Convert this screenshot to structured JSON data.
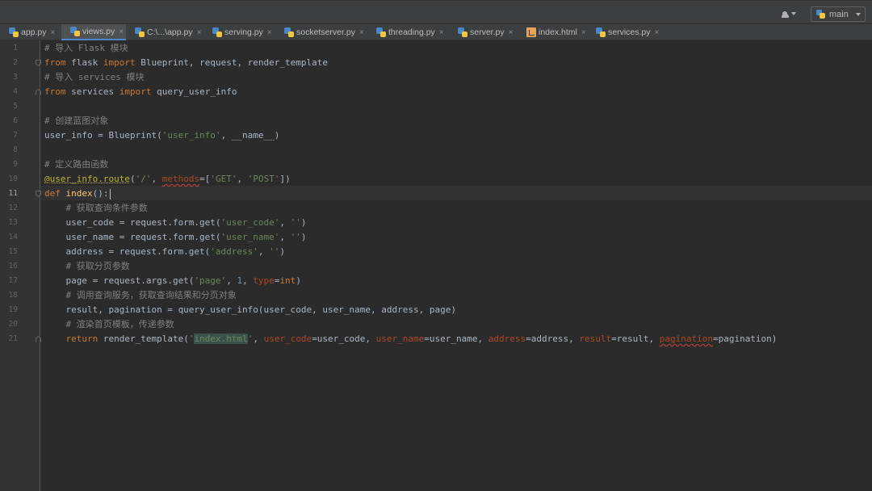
{
  "toolbar": {
    "user_icon": "user-icon",
    "branch_icon": "python-icon",
    "branch": "main"
  },
  "tabs": [
    {
      "label": "app.py",
      "icon": "python-file-icon"
    },
    {
      "label": "views.py",
      "icon": "python-file-icon",
      "active": true
    },
    {
      "label": "C:\\...\\app.py",
      "icon": "python-file-icon"
    },
    {
      "label": "serving.py",
      "icon": "python-file-icon"
    },
    {
      "label": "socketserver.py",
      "icon": "python-file-icon"
    },
    {
      "label": "threading.py",
      "icon": "python-file-icon"
    },
    {
      "label": "server.py",
      "icon": "python-file-icon"
    },
    {
      "label": "index.html",
      "icon": "html-file-icon"
    },
    {
      "label": "services.py",
      "icon": "python-file-icon"
    }
  ],
  "close_glyph": "×",
  "editor": {
    "current_line": "11",
    "line_numbers": [
      "1",
      "2",
      "3",
      "4",
      "5",
      "6",
      "7",
      "8",
      "9",
      "10",
      "11",
      "12",
      "13",
      "14",
      "15",
      "16",
      "17",
      "18",
      "19",
      "20",
      "21"
    ],
    "colors": {
      "keyword": "#cc7832",
      "string": "#6a8759",
      "comment": "#808080",
      "decorator": "#bbb529",
      "number": "#6897bb",
      "param": "#aa4926",
      "default": "#a9b7c6"
    },
    "lines": [
      [
        {
          "t": "# 导入 Flask 模块",
          "c": "c"
        }
      ],
      [
        {
          "t": "from",
          "c": "k"
        },
        {
          "t": " flask "
        },
        {
          "t": "import",
          "c": "k"
        },
        {
          "t": " Blueprint, request, render_template"
        }
      ],
      [
        {
          "t": "# 导入 services 模块",
          "c": "c"
        }
      ],
      [
        {
          "t": "from",
          "c": "k"
        },
        {
          "t": " services "
        },
        {
          "t": "import",
          "c": "k"
        },
        {
          "t": " query_user_info"
        }
      ],
      [],
      [
        {
          "t": "# 创建蓝图对象",
          "c": "c"
        }
      ],
      [
        {
          "t": "user_info = Blueprint("
        },
        {
          "t": "'user_info'",
          "c": "s"
        },
        {
          "t": ", __name__)"
        }
      ],
      [],
      [
        {
          "t": "# 定义路由函数",
          "c": "c"
        }
      ],
      [
        {
          "t": "@user_info.route",
          "c": "d dots"
        },
        {
          "t": "("
        },
        {
          "t": "'/'",
          "c": "s"
        },
        {
          "t": ", "
        },
        {
          "t": "methods",
          "c": "p wave"
        },
        {
          "t": "=["
        },
        {
          "t": "'GET'",
          "c": "s"
        },
        {
          "t": ", "
        },
        {
          "t": "'POST'",
          "c": "s"
        },
        {
          "t": "])"
        }
      ],
      [
        {
          "t": "def",
          "c": "k"
        },
        {
          "t": " "
        },
        {
          "t": "index",
          "c": "f"
        },
        {
          "t": "():"
        }
      ],
      [
        {
          "t": "    "
        },
        {
          "t": "# 获取查询条件参数",
          "c": "c"
        }
      ],
      [
        {
          "t": "    user_code = request.form.get("
        },
        {
          "t": "'user_code'",
          "c": "s"
        },
        {
          "t": ", "
        },
        {
          "t": "''",
          "c": "s"
        },
        {
          "t": ")"
        }
      ],
      [
        {
          "t": "    user_name = request.form.get("
        },
        {
          "t": "'user_name'",
          "c": "s"
        },
        {
          "t": ", "
        },
        {
          "t": "''",
          "c": "s"
        },
        {
          "t": ")"
        }
      ],
      [
        {
          "t": "    address = request.form.get("
        },
        {
          "t": "'address'",
          "c": "s"
        },
        {
          "t": ", "
        },
        {
          "t": "''",
          "c": "s"
        },
        {
          "t": ")"
        }
      ],
      [
        {
          "t": "    "
        },
        {
          "t": "# 获取分页参数",
          "c": "c"
        }
      ],
      [
        {
          "t": "    page = request.args.get("
        },
        {
          "t": "'page'",
          "c": "s"
        },
        {
          "t": ", "
        },
        {
          "t": "1",
          "c": "n"
        },
        {
          "t": ", "
        },
        {
          "t": "type",
          "c": "p"
        },
        {
          "t": "="
        },
        {
          "t": "int",
          "c": "k"
        },
        {
          "t": ")"
        }
      ],
      [
        {
          "t": "    "
        },
        {
          "t": "# 调用查询服务，获取查询结果和分页对象",
          "c": "c"
        }
      ],
      [
        {
          "t": "    result, pagination = query_user_info(user_code, user_name, address, page)"
        }
      ],
      [
        {
          "t": "    "
        },
        {
          "t": "# 渲染首页模板，传递参数",
          "c": "c"
        }
      ],
      [
        {
          "t": "    "
        },
        {
          "t": "return",
          "c": "k"
        },
        {
          "t": " render_template("
        },
        {
          "t": "'",
          "c": "s"
        },
        {
          "t": "index.html",
          "c": "s hl"
        },
        {
          "t": "'",
          "c": "s"
        },
        {
          "t": ", "
        },
        {
          "t": "user_code",
          "c": "p"
        },
        {
          "t": "=user_code, "
        },
        {
          "t": "user_name",
          "c": "p"
        },
        {
          "t": "=user_name, "
        },
        {
          "t": "address",
          "c": "p"
        },
        {
          "t": "=address, "
        },
        {
          "t": "result",
          "c": "p"
        },
        {
          "t": "=result, "
        },
        {
          "t": "pagination",
          "c": "p wave"
        },
        {
          "t": "=pagination)"
        }
      ]
    ]
  }
}
